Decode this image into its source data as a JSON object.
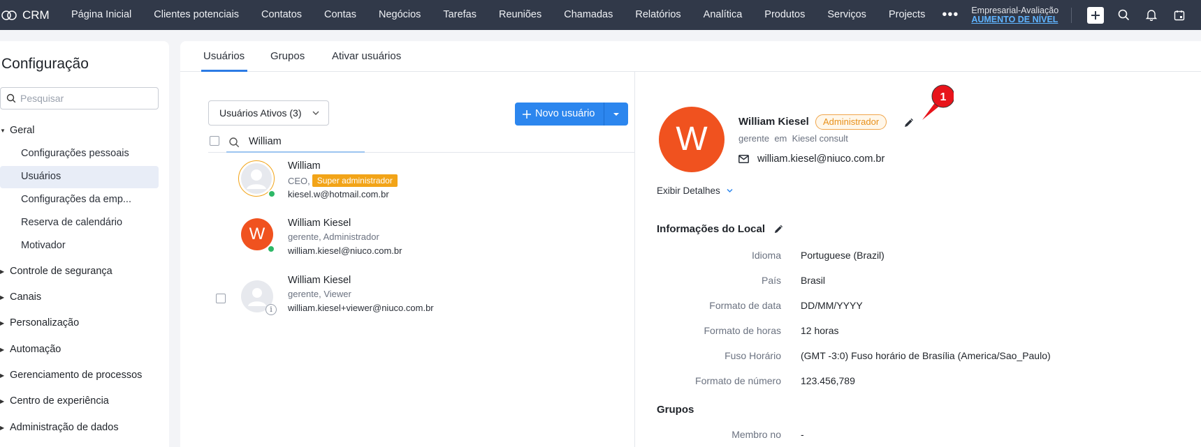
{
  "app": {
    "name": "CRM"
  },
  "nav": {
    "items": [
      "Página Inicial",
      "Clientes potenciais",
      "Contatos",
      "Contas",
      "Negócios",
      "Tarefas",
      "Reuniões",
      "Chamadas",
      "Relatórios",
      "Analítica",
      "Produtos",
      "Serviços",
      "Projects"
    ],
    "more": "•••",
    "edition": "Empresarial-Avaliação",
    "upgrade": "AUMENTO DE NÍVEL"
  },
  "sidebar": {
    "title": "Configuração",
    "search_placeholder": "Pesquisar",
    "general": "Geral",
    "general_items": [
      "Configurações pessoais",
      "Usuários",
      "Configurações da emp...",
      "Reserva de calendário",
      "Motivador"
    ],
    "groups": [
      "Controle de segurança",
      "Canais",
      "Personalização",
      "Automação",
      "Gerenciamento de processos",
      "Centro de experiência",
      "Administração de dados"
    ]
  },
  "tabs": [
    "Usuários",
    "Grupos",
    "Ativar usuários"
  ],
  "list": {
    "filter": "Usuários Ativos (3)",
    "new_user": "Novo usuário",
    "query": "William",
    "users": [
      {
        "name": "William",
        "role": "CEO,",
        "badge": "Super administrador",
        "email": "kiesel.w@hotmail.com.br"
      },
      {
        "name": "William Kiesel",
        "initial": "W",
        "role": "gerente, Administrador",
        "email": "william.kiesel@niuco.com.br"
      },
      {
        "name": "William Kiesel",
        "role": "gerente, Viewer",
        "email": "william.kiesel+viewer@niuco.com.br"
      }
    ]
  },
  "detail": {
    "initial": "W",
    "name": "William Kiesel",
    "badge": "Administrador",
    "subtitle": "gerente  em  Kiesel consult",
    "email": "william.kiesel@niuco.com.br",
    "show_details": "Exibir Detalhes",
    "locale_title": "Informações do Local",
    "locale": [
      {
        "label": "Idioma",
        "value": "Portuguese (Brazil)"
      },
      {
        "label": "País",
        "value": "Brasil"
      },
      {
        "label": "Formato de data",
        "value": "DD/MM/YYYY"
      },
      {
        "label": "Formato de horas",
        "value": "12 horas"
      },
      {
        "label": "Fuso Horário",
        "value": "(GMT -3:0) Fuso horário de Brasília (America/Sao_Paulo)"
      },
      {
        "label": "Formato de número",
        "value": "123.456,789"
      }
    ],
    "groups_title": "Grupos",
    "groups": [
      {
        "label": "Membro no",
        "value": "-"
      }
    ]
  },
  "annotation": {
    "number": "1",
    "color": "#e8141b"
  },
  "colors": {
    "topbar": "#313949",
    "accent": "#2c86ee",
    "avatar": "#f0521f",
    "badge_super": "#f2a418"
  }
}
